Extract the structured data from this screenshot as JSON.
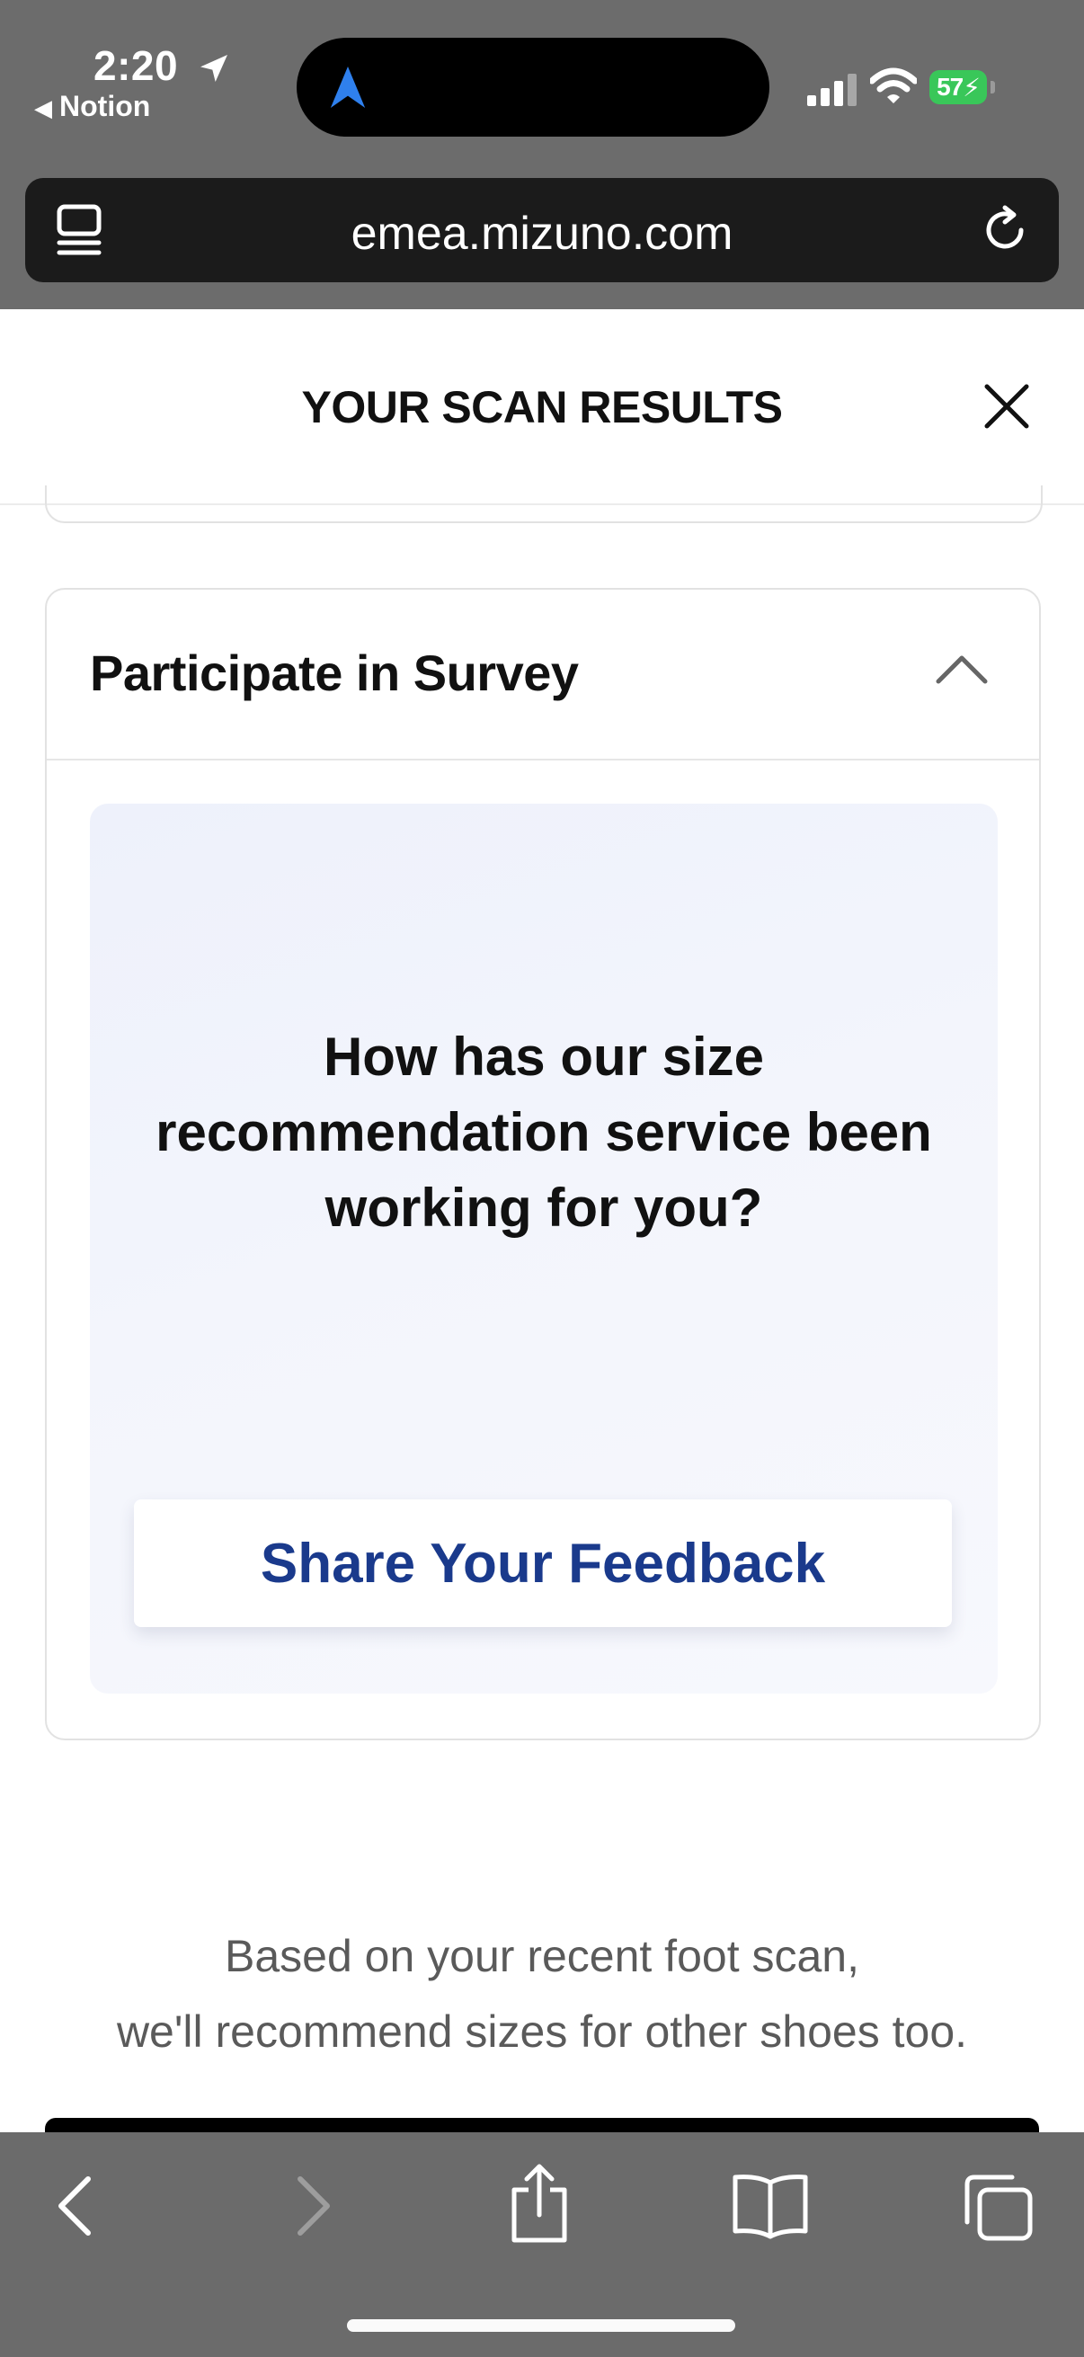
{
  "status_bar": {
    "time": "2:20",
    "back_app": "Notion",
    "battery": "57"
  },
  "browser": {
    "url": "emea.mizuno.com"
  },
  "header": {
    "title": "YOUR SCAN RESULTS"
  },
  "survey": {
    "title": "Participate in Survey",
    "question": "How has our size recommendation service been working for you?",
    "button_label": "Share Your Feedback"
  },
  "recommend": {
    "line1": "Based on your recent foot scan,",
    "line2": "we'll recommend sizes for other shoes too."
  },
  "colors": {
    "accent": "#1a3a8c",
    "battery": "#39c759",
    "location_blue": "#2f80ed"
  }
}
